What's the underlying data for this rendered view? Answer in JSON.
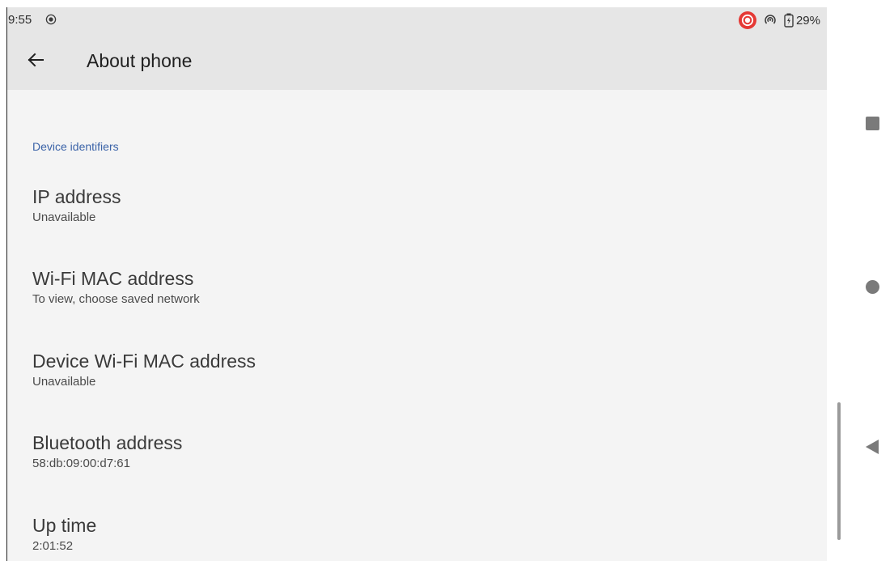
{
  "status_bar": {
    "time": "9:55",
    "battery_percent": "29%",
    "icons": [
      "screen-record-icon",
      "recording-alert-icon",
      "hotspot-icon",
      "battery-charging-icon"
    ]
  },
  "app_bar": {
    "title": "About phone",
    "back_icon": "arrow-back-icon"
  },
  "section": {
    "header": "Device identifiers"
  },
  "preferences": [
    {
      "title": "IP address",
      "summary": "Unavailable"
    },
    {
      "title": "Wi-Fi MAC address",
      "summary": "To view, choose saved network"
    },
    {
      "title": "Device Wi-Fi MAC address",
      "summary": "Unavailable"
    },
    {
      "title": "Bluetooth address",
      "summary": "58:db:09:00:d7:61"
    },
    {
      "title": "Up time",
      "summary": "2:01:52"
    }
  ],
  "nav_bar": {
    "icons": [
      "recents-square-icon",
      "home-circle-icon",
      "back-triangle-icon"
    ]
  },
  "colors": {
    "accent": "#3b63a8",
    "alert_red": "#e53935",
    "app_bar_bg": "#e6e6e6",
    "content_bg": "#f4f4f4"
  }
}
